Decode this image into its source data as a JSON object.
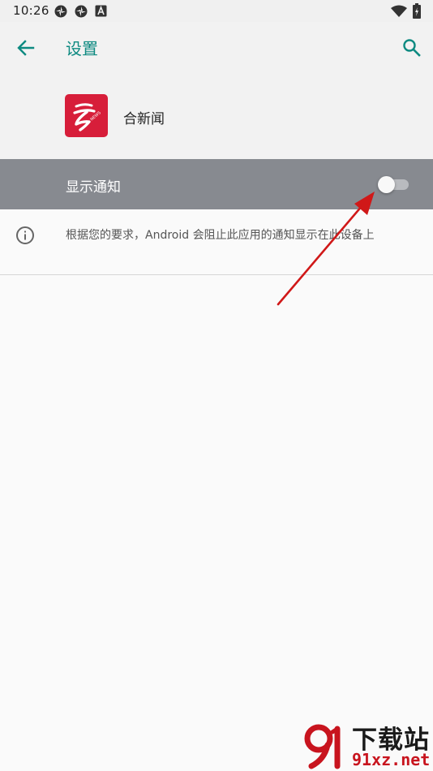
{
  "status_bar": {
    "time": "10:26",
    "icons": [
      "hotspot-icon",
      "hotspot-icon",
      "a-icon",
      "wifi-icon",
      "battery-icon"
    ]
  },
  "toolbar": {
    "title": "设置",
    "back_icon": "arrow-back-icon",
    "search_icon": "search-icon"
  },
  "app": {
    "name": "合新闻",
    "icon_color": "#d71e3a"
  },
  "notification": {
    "label": "显示通知",
    "enabled": false
  },
  "info": {
    "text": "根据您的要求，Android 会阻止此应用的通知显示在此设备上"
  },
  "watermark": {
    "title": "下载站",
    "domain": "91xz.net"
  },
  "colors": {
    "accent": "#0e8a81",
    "row_highlight": "#878a90",
    "annotation": "#d01818"
  }
}
